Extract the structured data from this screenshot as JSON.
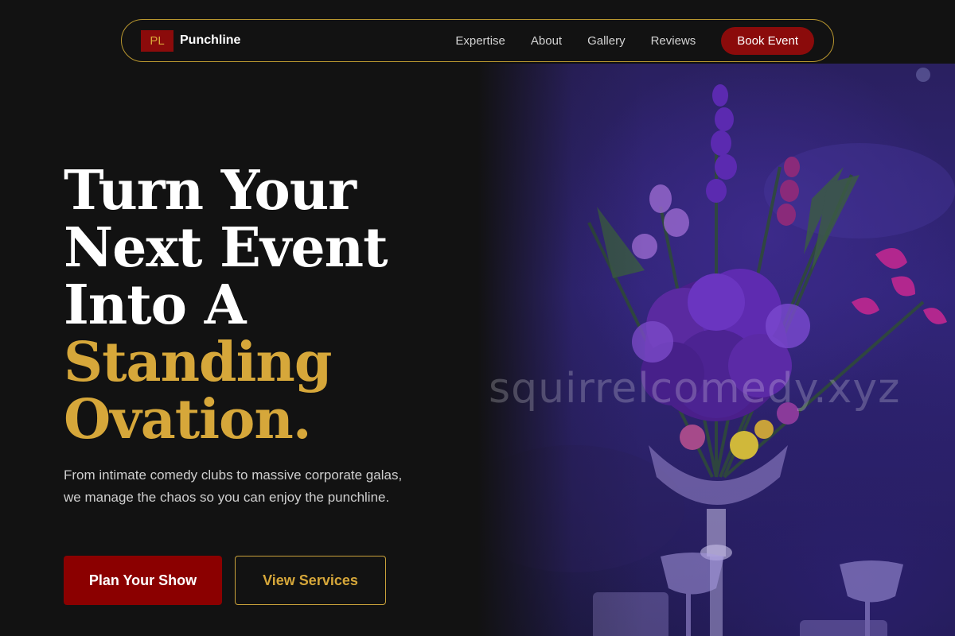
{
  "nav": {
    "badge": "PL",
    "brand": "Punchline",
    "links": [
      "Expertise",
      "About",
      "Gallery",
      "Reviews"
    ],
    "cta": "Book Event"
  },
  "hero": {
    "title_lines": [
      "Turn Your",
      "Next Event",
      "Into A"
    ],
    "title_highlight_lines": [
      "Standing",
      "Ovation."
    ],
    "subtitle": "From intimate comedy clubs to massive corporate galas, we manage the chaos so you can enjoy the punchline.",
    "primary_button": "Plan Your Show",
    "secondary_button": "View Services",
    "watermark": "squirrelcomedy.xyz"
  },
  "colors": {
    "background": "#121212",
    "accent_red": "#8b0000",
    "accent_gold": "#d6a73a"
  }
}
